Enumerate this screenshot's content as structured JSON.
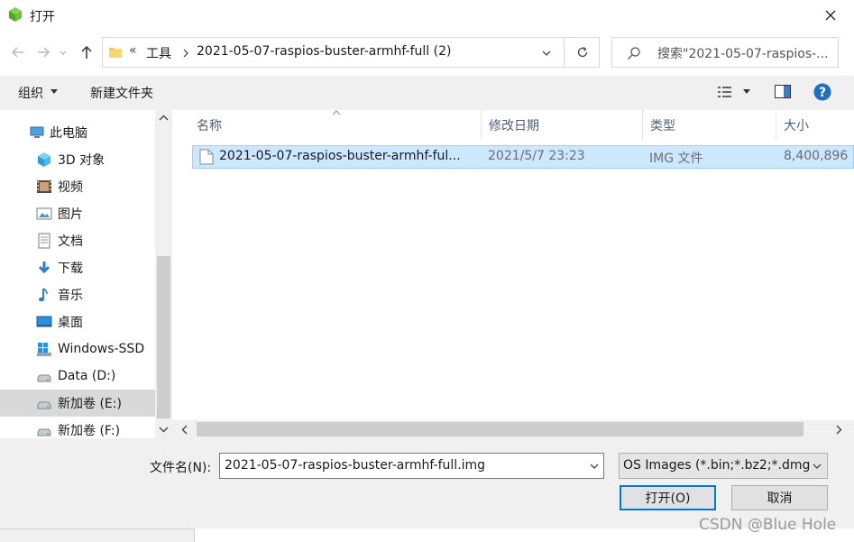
{
  "window": {
    "title": "打开"
  },
  "address": {
    "overflow": "«",
    "crumbs": [
      "工具",
      "2021-05-07-raspios-buster-armhf-full (2)"
    ]
  },
  "search": {
    "text": "搜索\"2021-05-07-raspios-..."
  },
  "toolbar": {
    "organize": "组织",
    "new_folder": "新建文件夹"
  },
  "sidebar": {
    "items": [
      {
        "label": "此电脑",
        "icon": "computer-icon"
      },
      {
        "label": "3D 对象",
        "icon": "3d-objects-icon"
      },
      {
        "label": "视频",
        "icon": "video-icon"
      },
      {
        "label": "图片",
        "icon": "pictures-icon"
      },
      {
        "label": "文档",
        "icon": "documents-icon"
      },
      {
        "label": "下载",
        "icon": "download-icon"
      },
      {
        "label": "音乐",
        "icon": "music-icon"
      },
      {
        "label": "桌面",
        "icon": "desktop-icon"
      },
      {
        "label": "Windows-SSD",
        "icon": "windows-drive-icon"
      },
      {
        "label": "Data (D:)",
        "icon": "drive-icon"
      },
      {
        "label": "新加卷 (E:)",
        "icon": "drive-icon"
      },
      {
        "label": "新加卷 (F:)",
        "icon": "drive-icon"
      }
    ]
  },
  "columns": {
    "name": "名称",
    "modified": "修改日期",
    "type": "类型",
    "size": "大小"
  },
  "files": [
    {
      "name": "2021-05-07-raspios-buster-armhf-ful...",
      "modified": "2021/5/7 23:23",
      "type": "IMG 文件",
      "size": "8,400,896"
    }
  ],
  "bottom": {
    "filename_label": "文件名(N):",
    "filename_value": "2021-05-07-raspios-buster-armhf-full.img",
    "filter": "OS Images (*.bin;*.bz2;*.dmg",
    "open": "打开(O)",
    "cancel": "取消"
  },
  "watermark": "CSDN @Blue Hole",
  "colors": {
    "selection": "#cce8ff",
    "selection_border": "#99d1ff",
    "accent": "#0078d7",
    "help": "#1f6fc5"
  }
}
